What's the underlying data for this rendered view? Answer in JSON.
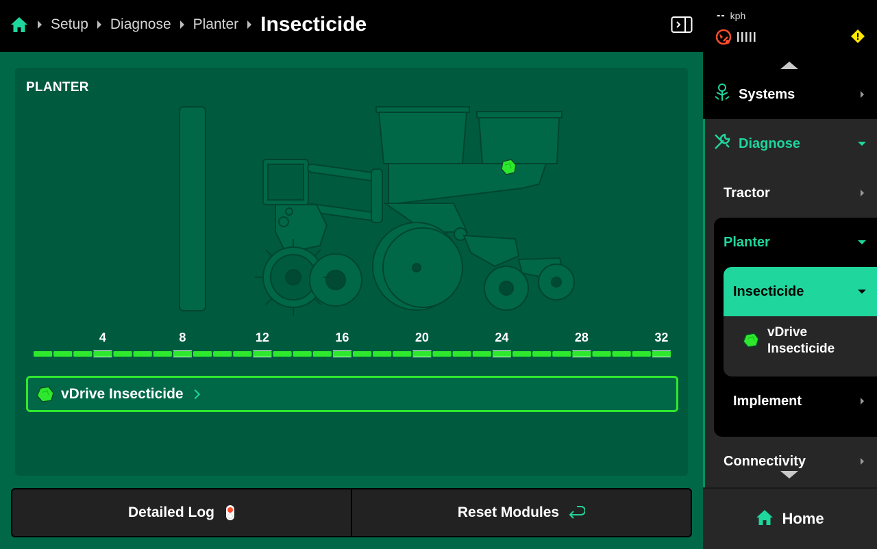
{
  "breadcrumb": {
    "home_icon": "home-icon",
    "items": [
      "Setup",
      "Diagnose",
      "Planter"
    ],
    "current": "Insecticide"
  },
  "status": {
    "speed_value": "--",
    "speed_unit": "kph",
    "gps_status": "gps-error",
    "warning": "warning-icon"
  },
  "sidebar": {
    "systems": "Systems",
    "diagnose": "Diagnose",
    "tractor": "Tractor",
    "planter": "Planter",
    "insecticide": "Insecticide",
    "vdrive_line1": "vDrive",
    "vdrive_line2": "Insecticide",
    "implement": "Implement",
    "connectivity": "Connectivity",
    "home": "Home"
  },
  "main": {
    "panel_title": "PLANTER",
    "row_labels": [
      "4",
      "8",
      "12",
      "16",
      "20",
      "24",
      "28",
      "32"
    ],
    "row_count": 32,
    "product_label": "vDrive Insecticide"
  },
  "buttons": {
    "detailed_log": "Detailed Log",
    "reset_modules": "Reset Modules"
  },
  "colors": {
    "accent": "#1fd69c",
    "status_ok": "#2ee82e",
    "background": "#006847",
    "warning": "#ffe600"
  }
}
